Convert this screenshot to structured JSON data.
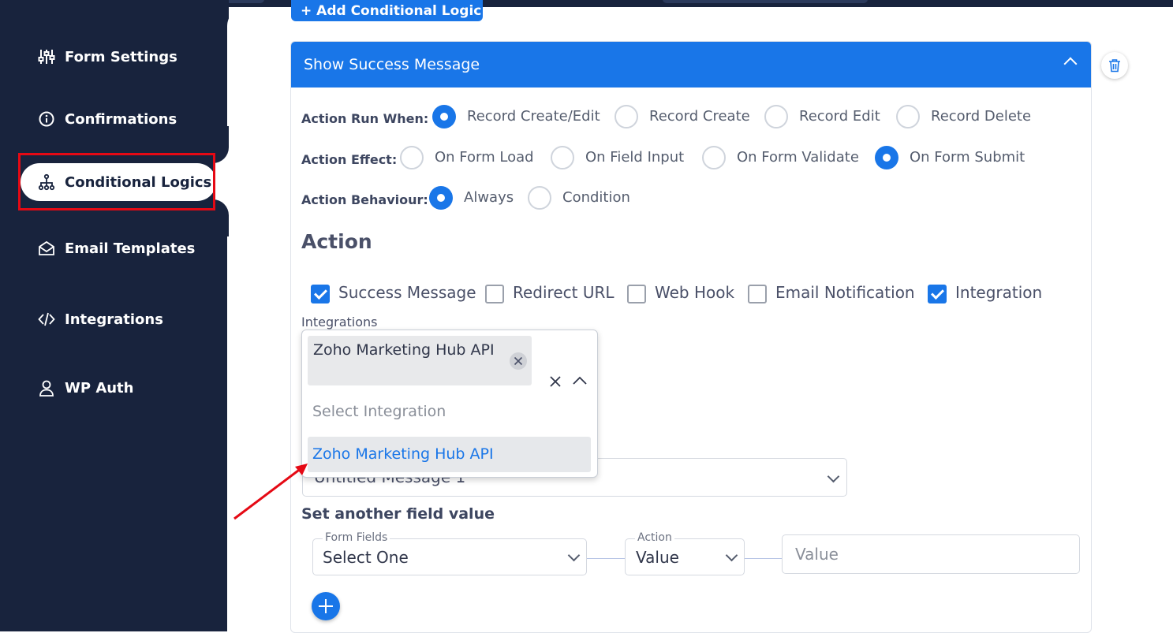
{
  "sidebar": {
    "items": [
      {
        "label": "Form Settings",
        "icon": "sliders-icon"
      },
      {
        "label": "Confirmations",
        "icon": "info-icon"
      },
      {
        "label": "Conditional Logics",
        "icon": "sitemap-icon",
        "active": true
      },
      {
        "label": "Email Templates",
        "icon": "envelope-open-icon"
      },
      {
        "label": "Integrations",
        "icon": "code-icon"
      },
      {
        "label": "WP Auth",
        "icon": "user-icon"
      }
    ]
  },
  "main": {
    "add_button_label": "+ Add Conditional Logic",
    "card": {
      "title": "Show Success Message",
      "action_run_when": {
        "label": "Action Run When:",
        "options": [
          "Record Create/Edit",
          "Record Create",
          "Record Edit",
          "Record Delete"
        ],
        "selected": "Record Create/Edit"
      },
      "action_effect": {
        "label": "Action Effect:",
        "options": [
          "On Form Load",
          "On Field Input",
          "On Form Validate",
          "On Form Submit"
        ],
        "selected": "On Form Submit"
      },
      "action_behaviour": {
        "label": "Action Behaviour:",
        "options": [
          "Always",
          "Condition"
        ],
        "selected": "Always"
      },
      "action_heading": "Action",
      "actions": [
        {
          "label": "Success Message",
          "checked": true
        },
        {
          "label": "Redirect URL",
          "checked": false
        },
        {
          "label": "Web Hook",
          "checked": false
        },
        {
          "label": "Email Notification",
          "checked": false
        },
        {
          "label": "Integration",
          "checked": true
        }
      ],
      "integrations": {
        "label": "Integrations",
        "chip": "Zoho Marketing Hub API",
        "placeholder": "Select Integration",
        "options": [
          "Zoho Marketing Hub API"
        ]
      },
      "message_select_value": "Untitled Message 1",
      "set_field": {
        "heading": "Set another field value",
        "form_fields_label": "Form Fields",
        "form_fields_value": "Select One",
        "action_label": "Action",
        "action_value": "Value",
        "value_placeholder": "Value"
      }
    }
  },
  "colors": {
    "sidebar_bg": "#18233d",
    "accent": "#1976e8",
    "highlight_box": "#e50914",
    "annotation_arrow": "#e50914"
  }
}
